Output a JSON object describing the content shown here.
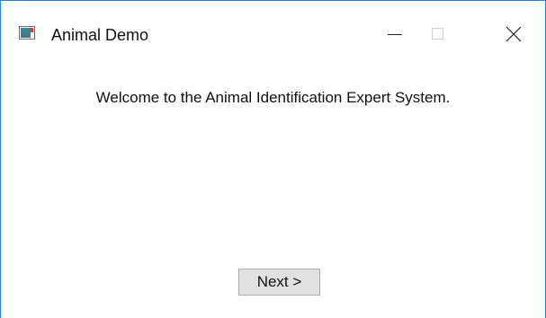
{
  "window": {
    "title": "Animal Demo",
    "icon": "app-window-icon",
    "controls": {
      "minimize": "minimize-icon",
      "maximize": "maximize-icon",
      "close": "close-icon"
    }
  },
  "main": {
    "welcome_text": "Welcome to the Animal Identification Expert System.",
    "next_label": "Next >"
  },
  "colors": {
    "border_accent": "#2b7fd4",
    "button_bg": "#e1e1e1",
    "button_border": "#adadad"
  }
}
